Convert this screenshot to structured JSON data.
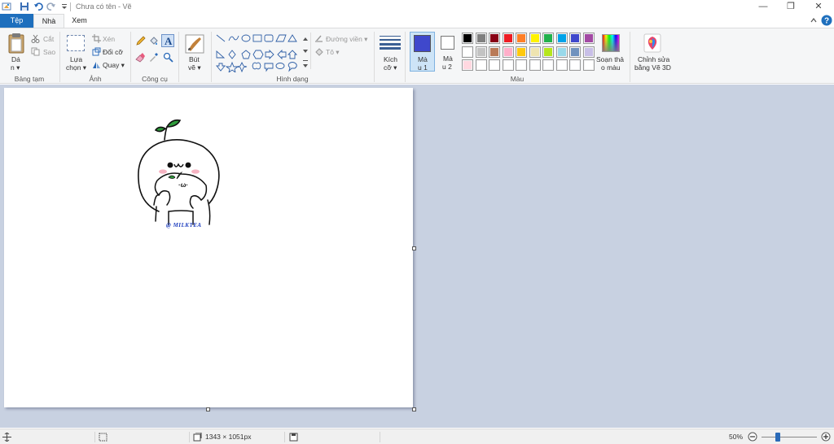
{
  "window": {
    "title": "Chưa có tên - Vẽ",
    "minimize_glyph": "—",
    "restore_glyph": "❐",
    "close_glyph": "✕"
  },
  "tabs": {
    "file": "Tệp",
    "home": "Nhà",
    "view": "Xem"
  },
  "ribbon": {
    "clipboard": {
      "paste_line1": "Dá",
      "paste_line2": "n ▾",
      "cut": "Cắt",
      "copy": "Sao",
      "label": "Bảng tạm"
    },
    "image": {
      "select_line1": "Lựa",
      "select_line2": "chọn ▾",
      "crop": "Xén",
      "resize": "Đổi cỡ",
      "rotate": "Quay ▾",
      "label": "Ảnh"
    },
    "tools": {
      "text_glyph": "A",
      "label": "Công cụ"
    },
    "brushes": {
      "line1": "Bút",
      "line2": "vẽ ▾"
    },
    "shapes": {
      "outline": "Đường viền ▾",
      "fill": "Tô ▾",
      "label": "Hình dạng"
    },
    "size": {
      "line1": "Kích",
      "line2": "cỡ ▾"
    },
    "color1": {
      "line1": "Mà",
      "line2": "u 1",
      "value": "#3f48cc"
    },
    "color2": {
      "line1": "Mà",
      "line2": "u 2",
      "value": "#ffffff"
    },
    "edit_colors": {
      "line1": "Soạn thả",
      "line2": "o màu"
    },
    "paint3d": {
      "line1": "Chỉnh sửa",
      "line2": "bằng Vẽ 3D"
    },
    "colors_label": "Màu",
    "palette_row1": [
      "#000000",
      "#7f7f7f",
      "#880015",
      "#ed1c24",
      "#ff7f27",
      "#fff200",
      "#22b14c",
      "#00a2e8",
      "#3f48cc",
      "#a349a4"
    ],
    "palette_row2": [
      "#ffffff",
      "#c3c3c3",
      "#b97a57",
      "#ffaec9",
      "#ffc90e",
      "#efe4b0",
      "#b5e61d",
      "#99d9ea",
      "#7092be",
      "#c8bfe7"
    ],
    "palette_row3": [
      "#ffd8e0",
      "#ffffff",
      "#ffffff",
      "#ffffff",
      "#ffffff",
      "#ffffff",
      "#ffffff",
      "#ffffff",
      "#ffffff",
      "#ffffff"
    ]
  },
  "canvas": {
    "watermark": "@ MILKTEA"
  },
  "statusbar": {
    "dimensions": "1343 × 1051px",
    "zoom": "50%",
    "zoom_fraction": 0.3
  }
}
